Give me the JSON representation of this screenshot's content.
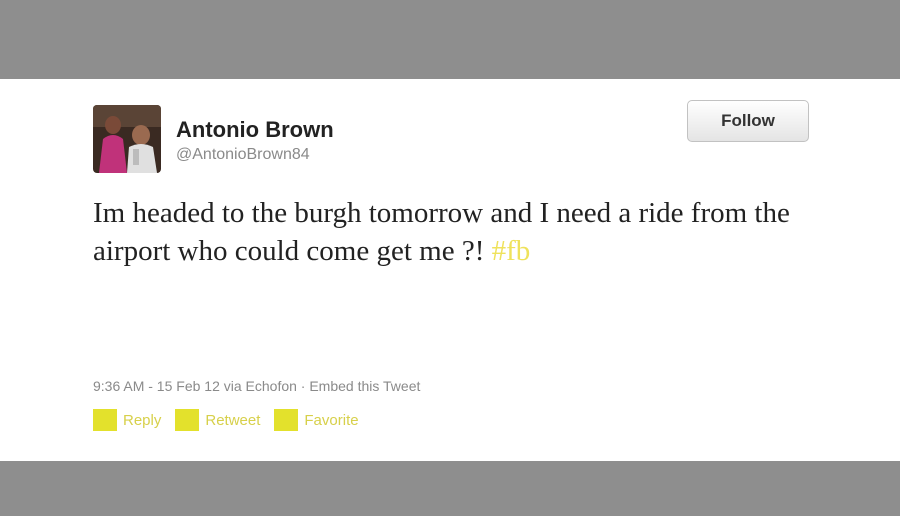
{
  "tweet": {
    "author_name": "Antonio Brown",
    "author_handle": "@AntonioBrown84",
    "follow_label": "Follow",
    "text": "Im headed to the burgh tomorrow and I need a ride from the airport who could come get me ?! ",
    "hashtag": "#fb",
    "meta": "9:36 AM - 15 Feb 12 via Echofon · Embed this Tweet",
    "actions": {
      "reply": "Reply",
      "retweet": "Retweet",
      "favorite": "Favorite"
    }
  },
  "colors": {
    "backdrop": "#8e8e8e",
    "card": "#ffffff",
    "hashtag": "#efe25b",
    "action_swatch": "#e3e12c",
    "muted_text": "#8a8a8a"
  },
  "icons": {
    "avatar": "profile-photo"
  }
}
